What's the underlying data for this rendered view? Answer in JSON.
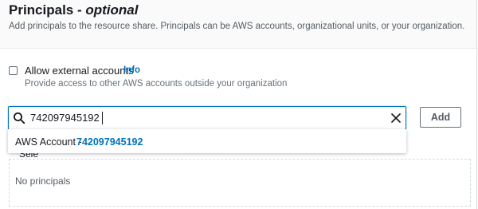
{
  "section": {
    "title": "Principals - ",
    "title_optional": "optional",
    "description": "Add principals to the resource share. Principals can be AWS accounts, organizational units, or your organization."
  },
  "external_accounts": {
    "label": "Allow external accounts",
    "info_link": "Info",
    "description": "Provide access to other AWS accounts outside your organization",
    "checked": false
  },
  "search": {
    "icon": "search-icon",
    "value": "742097945192",
    "clear_icon": "close-icon"
  },
  "add_button": {
    "label": "Add"
  },
  "suggestion": {
    "prefix": "AWS Account - ",
    "match": "742097945192"
  },
  "principals": {
    "partially_hidden_label": "Sele",
    "empty_text": "No principals"
  },
  "colors": {
    "accent": "#0073bb",
    "text": "#16191f",
    "muted": "#545b64",
    "border": "#d5dbdb"
  }
}
